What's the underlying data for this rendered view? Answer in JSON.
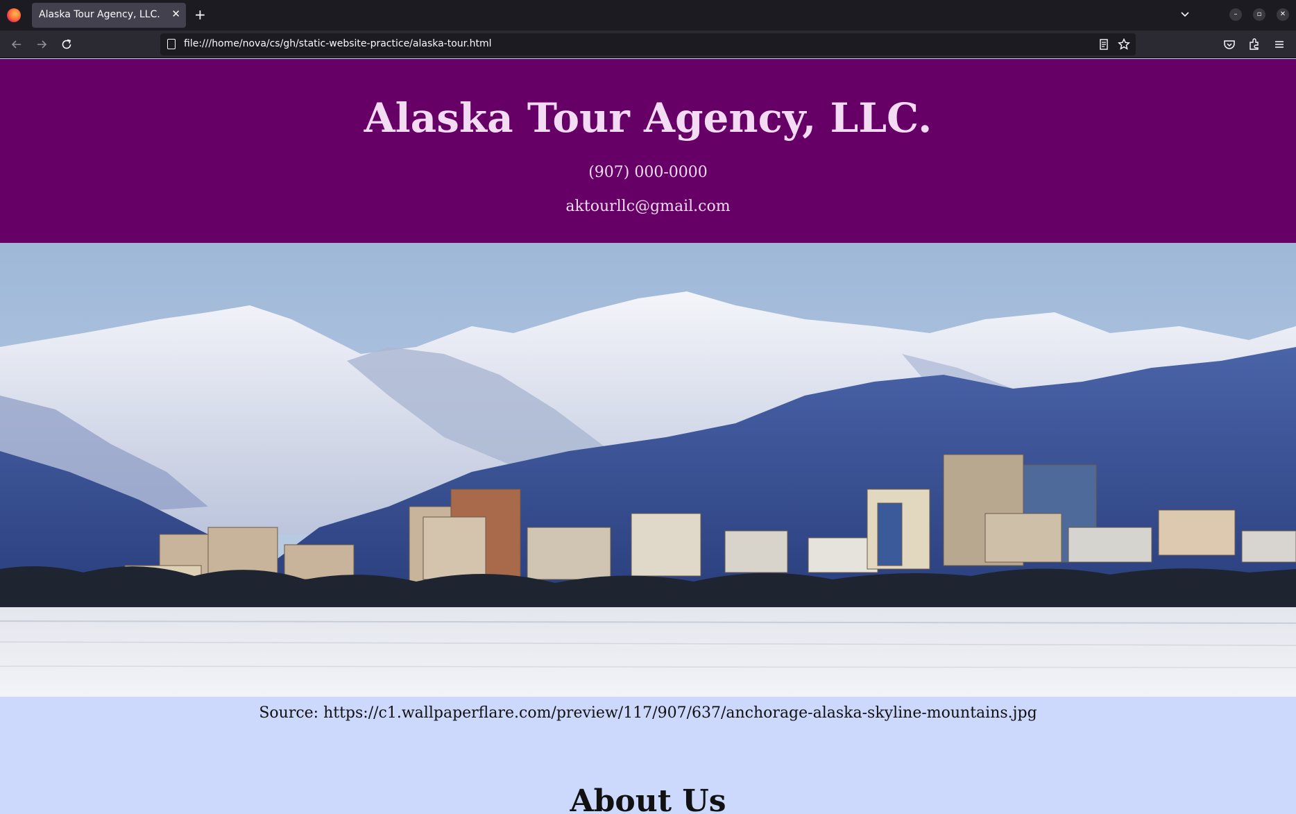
{
  "browser": {
    "tab_title": "Alaska Tour Agency, LLC.",
    "tab_close": "✕",
    "new_tab": "+",
    "url": "file:///home/nova/cs/gh/static-website-practice/alaska-tour.html",
    "icons": {
      "back": "back-arrow-icon",
      "forward": "forward-arrow-icon",
      "reload": "reload-icon",
      "reader": "reader-view-icon",
      "bookmark": "star-icon",
      "pocket": "pocket-icon",
      "extensions": "extensions-icon",
      "menu": "hamburger-menu-icon"
    }
  },
  "header": {
    "title": "Alaska Tour Agency, LLC.",
    "phone": "(907) 000-0000",
    "email": "aktourllc@gmail.com"
  },
  "hero": {
    "caption": "Source: https://c1.wallpaperflare.com/preview/117/907/637/anchorage-alaska-skyline-mountains.jpg"
  },
  "about": {
    "heading": "About Us"
  },
  "colors": {
    "header_bg": "#660066",
    "header_text": "#f3dcf3",
    "page_bg": "#ccd8fc"
  }
}
